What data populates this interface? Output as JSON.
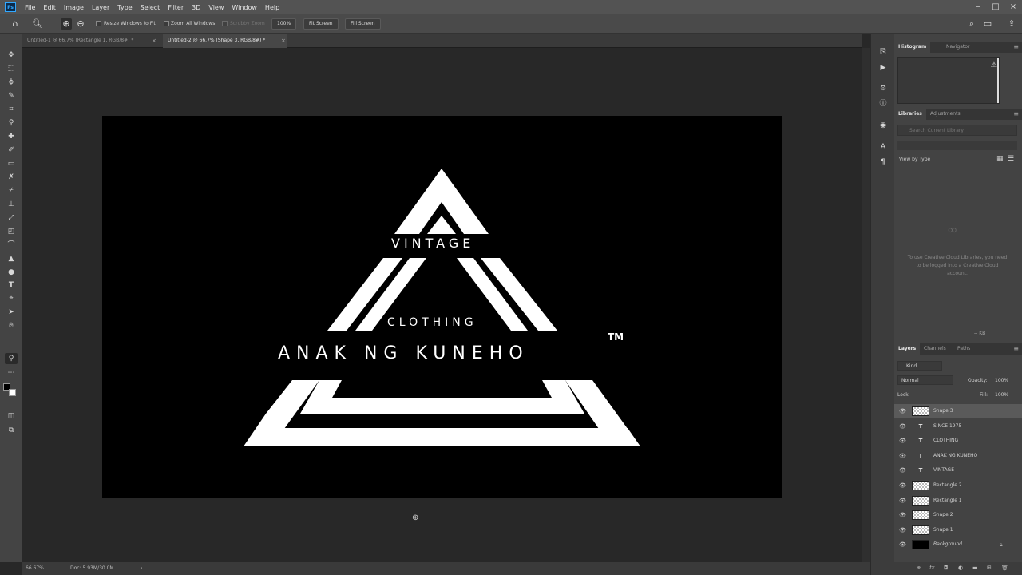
{
  "app": {
    "logo": "Ps"
  },
  "menu": [
    "File",
    "Edit",
    "Image",
    "Layer",
    "Type",
    "Select",
    "Filter",
    "3D",
    "View",
    "Window",
    "Help"
  ],
  "options": {
    "resize_windows": "Resize Windows to Fit",
    "zoom_all": "Zoom All Windows",
    "scrubby_zoom": "Scrubby Zoom",
    "zoom_value": "100%",
    "fit_screen": "Fit Screen",
    "fill_screen": "Fill Screen"
  },
  "tabs": [
    {
      "label": "Untitled-1 @ 66.7% (Rectangle 1, RGB/8#) *",
      "close": "×",
      "active": false
    },
    {
      "label": "Untitled-2 @ 66.7% (Shape 3, RGB/8#) *",
      "close": "×",
      "active": true
    }
  ],
  "logo_art": {
    "vintage": "VINTAGE",
    "clothing": "CLOTHING",
    "brand": "ANAK NG KUNEHO",
    "tm": "TM",
    "since": "SINCE 1975"
  },
  "status": {
    "zoom": "66.67%",
    "doc": "Doc: 5.93M/30.0M",
    "arrow": "›"
  },
  "panels": {
    "top_tabs": [
      "Histogram",
      "Navigator"
    ],
    "histogram_warning": "⚠",
    "mid_tabs": [
      "Libraries",
      "Adjustments"
    ],
    "library_search_placeholder": "Search Current Library",
    "view_by_type": "View by Type",
    "cc_message": "To use Creative Cloud Libraries, you need to be logged into a Creative Cloud account.",
    "kb": "-- KB",
    "layer_tabs": [
      "Layers",
      "Channels",
      "Paths"
    ],
    "kind_label": "Kind",
    "blend_mode": "Normal",
    "opacity_label": "Opacity:",
    "opacity_value": "100%",
    "lock_label": "Lock:",
    "fill_label": "Fill:",
    "fill_value": "100%",
    "menu_glyph": "≡"
  },
  "layers": [
    {
      "name": "Shape 3",
      "type": "shape",
      "selected": true
    },
    {
      "name": "SINCE 1975",
      "type": "text"
    },
    {
      "name": "CLOTHING",
      "type": "text"
    },
    {
      "name": "ANAK NG KUNEHO",
      "type": "text"
    },
    {
      "name": "VINTAGE",
      "type": "text"
    },
    {
      "name": "Rectangle 2",
      "type": "shape"
    },
    {
      "name": "Rectangle 1",
      "type": "shape"
    },
    {
      "name": "Shape 2",
      "type": "shape"
    },
    {
      "name": "Shape 1",
      "type": "shape"
    },
    {
      "name": "Background",
      "type": "background"
    }
  ],
  "icons": {
    "home": "home-icon",
    "zoom": "zoom-icon",
    "search": "search-icon",
    "eye": "eye-icon",
    "lock": "lock-icon"
  }
}
